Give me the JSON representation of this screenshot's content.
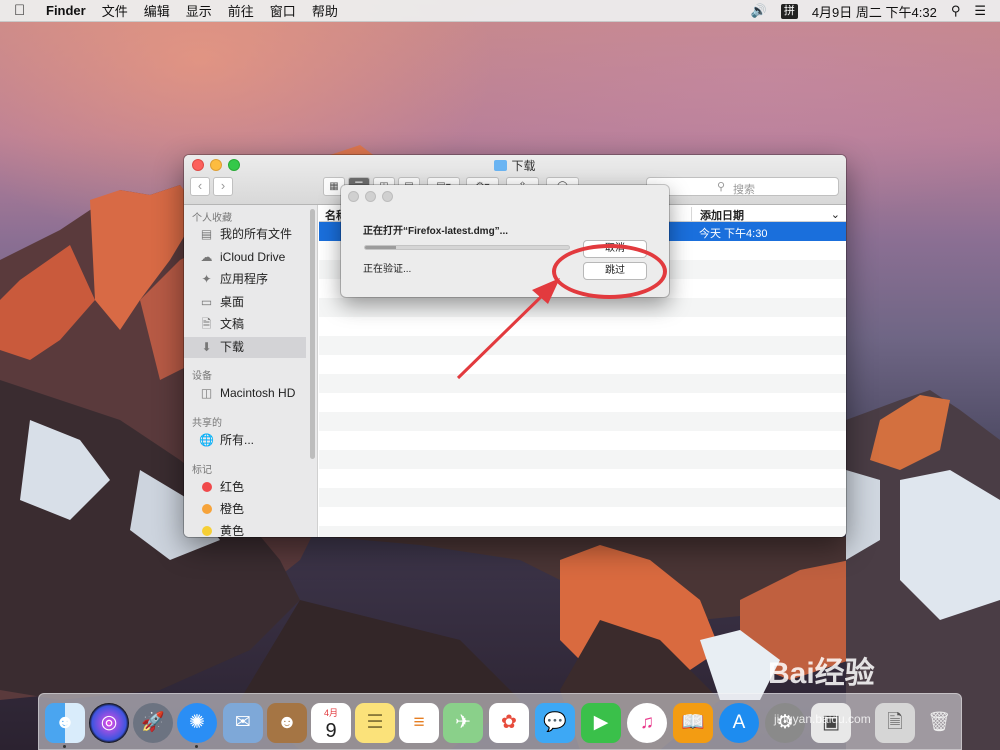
{
  "menubar": {
    "apple_icon": "apple-icon",
    "app_name": "Finder",
    "items": [
      "文件",
      "编辑",
      "显示",
      "前往",
      "窗口",
      "帮助"
    ],
    "ime": "拼",
    "clock": "4月9日 周二 下午4:32"
  },
  "finder": {
    "title": "下载",
    "search_placeholder": "搜索",
    "sidebar": {
      "favorites_header": "个人收藏",
      "favorites": [
        {
          "label": "我的所有文件",
          "icon": "all-files-icon"
        },
        {
          "label": "iCloud Drive",
          "icon": "cloud-icon"
        },
        {
          "label": "应用程序",
          "icon": "applications-icon"
        },
        {
          "label": "桌面",
          "icon": "desktop-icon"
        },
        {
          "label": "文稿",
          "icon": "documents-icon"
        },
        {
          "label": "下载",
          "icon": "downloads-icon"
        }
      ],
      "devices_header": "设备",
      "devices": [
        {
          "label": "Macintosh HD",
          "icon": "disk-icon"
        }
      ],
      "shared_header": "共享的",
      "shared": [
        {
          "label": "所有...",
          "icon": "network-icon"
        }
      ],
      "tags_header": "标记",
      "tags": [
        {
          "label": "红色",
          "color": "#f0494b"
        },
        {
          "label": "橙色",
          "color": "#f6a33a"
        },
        {
          "label": "黄色",
          "color": "#f6cf35"
        }
      ]
    },
    "columns": {
      "name": "名称",
      "date_added": "添加日期"
    },
    "selected_row_date": "今天 下午4:30"
  },
  "dialog": {
    "title": "正在打开“Firefox-latest.dmg”...",
    "status": "正在验证...",
    "progress": 0.15,
    "cancel_label": "取消",
    "skip_label": "跳过"
  },
  "annotation": {
    "color": "#e23a3e"
  },
  "dock": {
    "apps": [
      "finder-icon",
      "siri-icon",
      "launchpad-icon",
      "safari-icon",
      "mail-icon",
      "contacts-icon",
      "calendar-icon",
      "notes-icon",
      "reminders-icon",
      "maps-icon",
      "photos-icon",
      "messages-icon",
      "facetime-icon",
      "itunes-icon",
      "ibooks-icon",
      "app-store-icon",
      "system-preferences-icon",
      "preview-icon",
      "downloads-stack-icon",
      "trash-icon"
    ],
    "calendar_month": "4月",
    "calendar_day": "9"
  },
  "watermark": {
    "brand": "Bai经验",
    "url": "jingyan.baidu.com"
  }
}
